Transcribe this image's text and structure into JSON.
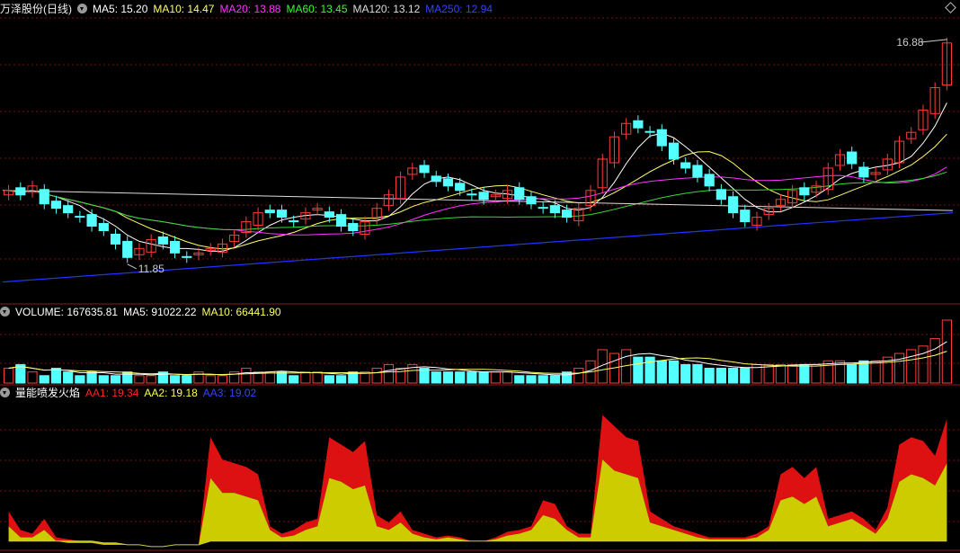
{
  "price_header": {
    "name": "万泽股份",
    "period": "(日线)",
    "ma5": "MA5: 15.20",
    "ma10": "MA10: 14.47",
    "ma20": "MA20: 13.88",
    "ma60": "MA60: 13.45",
    "ma120": "MA120: 13.12",
    "ma250": "MA250: 12.94"
  },
  "volume_header": {
    "volume": "VOLUME: 167635.81",
    "ma5": "MA5: 91022.22",
    "ma10": "MA10: 66441.90"
  },
  "indicator_header": {
    "name": "量能喷发火焰",
    "aa1": "AA1: 19.34",
    "aa2": "AA2: 19.18",
    "aa3": "AA3: 19.02"
  },
  "annotations": {
    "high_label": "16.88",
    "low_label": "11.85"
  },
  "colors": {
    "up": "#ff3b3b",
    "down": "#54ffff",
    "ma5": "#ffffff",
    "ma10": "#ffff66",
    "ma20": "#ff33ff",
    "ma60": "#33dd33",
    "ma120": "#dddddd",
    "ma250": "#2233ff",
    "aa1": "#dd1111",
    "aa2": "#cccc00",
    "aa3": "#2233ff"
  },
  "chart_data": [
    {
      "type": "candlestick",
      "title": "万泽股份(日线)",
      "ylim": [
        11.0,
        17.4
      ],
      "high": 16.88,
      "low": 11.85,
      "closes": [
        13.5,
        13.4,
        13.6,
        13.2,
        13.1,
        13.0,
        12.9,
        12.7,
        12.6,
        12.3,
        12.0,
        12.2,
        12.4,
        12.3,
        12.1,
        12.0,
        12.1,
        12.2,
        12.3,
        12.5,
        12.8,
        13.0,
        13.0,
        12.9,
        12.8,
        13.0,
        13.1,
        12.9,
        12.7,
        12.6,
        12.8,
        13.1,
        13.4,
        13.8,
        14.0,
        13.9,
        13.7,
        13.6,
        13.5,
        13.4,
        13.3,
        13.4,
        13.5,
        13.3,
        13.2,
        13.1,
        13.0,
        12.9,
        13.1,
        13.5,
        14.2,
        14.7,
        15.0,
        14.9,
        14.8,
        14.5,
        14.2,
        14.0,
        13.8,
        13.6,
        13.3,
        13.0,
        12.8,
        12.9,
        13.1,
        13.3,
        13.5,
        13.4,
        13.6,
        14.0,
        14.3,
        14.1,
        13.8,
        13.9,
        14.2,
        14.6,
        14.8,
        15.3,
        15.8,
        16.8
      ],
      "volumes": [
        4,
        5,
        3,
        2,
        4,
        3,
        2,
        3,
        2,
        2,
        3,
        2,
        2,
        3,
        2,
        2,
        3,
        2,
        2,
        3,
        4,
        3,
        3,
        3,
        2,
        3,
        3,
        2,
        2,
        3,
        3,
        4,
        5,
        4,
        5,
        4,
        3,
        3,
        3,
        3,
        3,
        3,
        3,
        2,
        2,
        2,
        2,
        3,
        4,
        6,
        9,
        8,
        9,
        7,
        7,
        6,
        6,
        5,
        5,
        4,
        4,
        4,
        4,
        5,
        5,
        5,
        5,
        5,
        5,
        6,
        6,
        5,
        6,
        6,
        7,
        8,
        9,
        10,
        12,
        17
      ]
    },
    {
      "type": "area",
      "title": "量能喷发火焰",
      "series": [
        {
          "name": "AA1",
          "values": [
            20,
            10,
            8,
            16,
            6,
            5,
            4,
            4,
            3,
            3,
            2,
            2,
            1,
            1,
            2,
            2,
            2,
            60,
            48,
            46,
            44,
            40,
            12,
            8,
            10,
            14,
            16,
            60,
            56,
            52,
            58,
            18,
            14,
            20,
            10,
            8,
            6,
            7,
            6,
            4,
            4,
            6,
            9,
            10,
            12,
            26,
            24,
            12,
            8,
            8,
            72,
            66,
            60,
            58,
            20,
            16,
            12,
            10,
            8,
            6,
            6,
            6,
            6,
            8,
            12,
            40,
            44,
            38,
            44,
            16,
            18,
            20,
            16,
            10,
            22,
            56,
            60,
            58,
            50,
            70
          ]
        },
        {
          "name": "AA2",
          "values": [
            12,
            6,
            6,
            10,
            4,
            3,
            3,
            3,
            2,
            2,
            2,
            2,
            1,
            1,
            2,
            2,
            2,
            38,
            30,
            30,
            28,
            26,
            10,
            6,
            7,
            10,
            12,
            38,
            36,
            32,
            34,
            12,
            10,
            14,
            8,
            6,
            5,
            6,
            5,
            4,
            4,
            5,
            7,
            8,
            10,
            18,
            16,
            10,
            6,
            6,
            48,
            42,
            40,
            38,
            14,
            12,
            10,
            8,
            6,
            5,
            5,
            5,
            5,
            6,
            10,
            26,
            28,
            24,
            28,
            12,
            14,
            16,
            12,
            8,
            16,
            36,
            40,
            38,
            34,
            46
          ]
        }
      ]
    }
  ]
}
